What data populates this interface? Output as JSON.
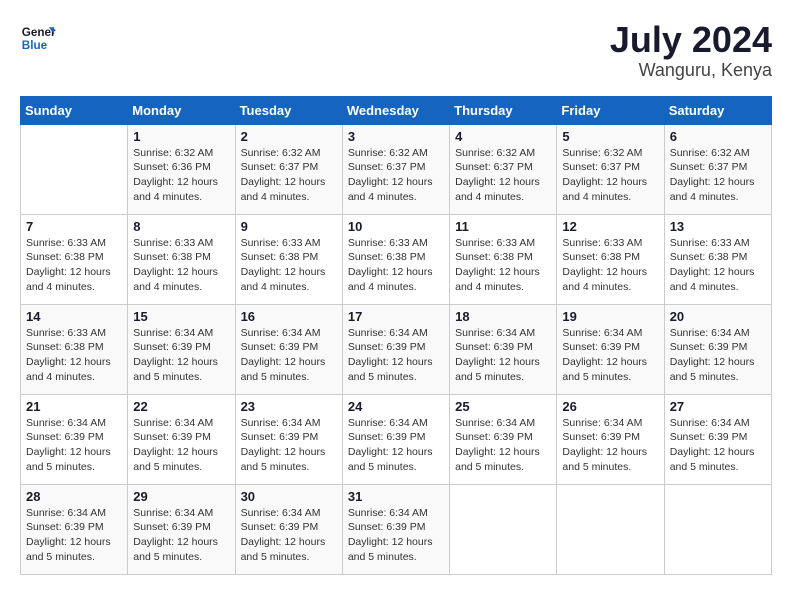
{
  "logo": {
    "line1": "General",
    "line2": "Blue"
  },
  "title": "July 2024",
  "location": "Wanguru, Kenya",
  "days_of_week": [
    "Sunday",
    "Monday",
    "Tuesday",
    "Wednesday",
    "Thursday",
    "Friday",
    "Saturday"
  ],
  "weeks": [
    [
      {
        "day": "",
        "sunrise": "",
        "sunset": "",
        "daylight": ""
      },
      {
        "day": "1",
        "sunrise": "Sunrise: 6:32 AM",
        "sunset": "Sunset: 6:36 PM",
        "daylight": "Daylight: 12 hours and 4 minutes."
      },
      {
        "day": "2",
        "sunrise": "Sunrise: 6:32 AM",
        "sunset": "Sunset: 6:37 PM",
        "daylight": "Daylight: 12 hours and 4 minutes."
      },
      {
        "day": "3",
        "sunrise": "Sunrise: 6:32 AM",
        "sunset": "Sunset: 6:37 PM",
        "daylight": "Daylight: 12 hours and 4 minutes."
      },
      {
        "day": "4",
        "sunrise": "Sunrise: 6:32 AM",
        "sunset": "Sunset: 6:37 PM",
        "daylight": "Daylight: 12 hours and 4 minutes."
      },
      {
        "day": "5",
        "sunrise": "Sunrise: 6:32 AM",
        "sunset": "Sunset: 6:37 PM",
        "daylight": "Daylight: 12 hours and 4 minutes."
      },
      {
        "day": "6",
        "sunrise": "Sunrise: 6:32 AM",
        "sunset": "Sunset: 6:37 PM",
        "daylight": "Daylight: 12 hours and 4 minutes."
      }
    ],
    [
      {
        "day": "7",
        "sunrise": "Sunrise: 6:33 AM",
        "sunset": "Sunset: 6:38 PM",
        "daylight": "Daylight: 12 hours and 4 minutes."
      },
      {
        "day": "8",
        "sunrise": "Sunrise: 6:33 AM",
        "sunset": "Sunset: 6:38 PM",
        "daylight": "Daylight: 12 hours and 4 minutes."
      },
      {
        "day": "9",
        "sunrise": "Sunrise: 6:33 AM",
        "sunset": "Sunset: 6:38 PM",
        "daylight": "Daylight: 12 hours and 4 minutes."
      },
      {
        "day": "10",
        "sunrise": "Sunrise: 6:33 AM",
        "sunset": "Sunset: 6:38 PM",
        "daylight": "Daylight: 12 hours and 4 minutes."
      },
      {
        "day": "11",
        "sunrise": "Sunrise: 6:33 AM",
        "sunset": "Sunset: 6:38 PM",
        "daylight": "Daylight: 12 hours and 4 minutes."
      },
      {
        "day": "12",
        "sunrise": "Sunrise: 6:33 AM",
        "sunset": "Sunset: 6:38 PM",
        "daylight": "Daylight: 12 hours and 4 minutes."
      },
      {
        "day": "13",
        "sunrise": "Sunrise: 6:33 AM",
        "sunset": "Sunset: 6:38 PM",
        "daylight": "Daylight: 12 hours and 4 minutes."
      }
    ],
    [
      {
        "day": "14",
        "sunrise": "Sunrise: 6:33 AM",
        "sunset": "Sunset: 6:38 PM",
        "daylight": "Daylight: 12 hours and 4 minutes."
      },
      {
        "day": "15",
        "sunrise": "Sunrise: 6:34 AM",
        "sunset": "Sunset: 6:39 PM",
        "daylight": "Daylight: 12 hours and 5 minutes."
      },
      {
        "day": "16",
        "sunrise": "Sunrise: 6:34 AM",
        "sunset": "Sunset: 6:39 PM",
        "daylight": "Daylight: 12 hours and 5 minutes."
      },
      {
        "day": "17",
        "sunrise": "Sunrise: 6:34 AM",
        "sunset": "Sunset: 6:39 PM",
        "daylight": "Daylight: 12 hours and 5 minutes."
      },
      {
        "day": "18",
        "sunrise": "Sunrise: 6:34 AM",
        "sunset": "Sunset: 6:39 PM",
        "daylight": "Daylight: 12 hours and 5 minutes."
      },
      {
        "day": "19",
        "sunrise": "Sunrise: 6:34 AM",
        "sunset": "Sunset: 6:39 PM",
        "daylight": "Daylight: 12 hours and 5 minutes."
      },
      {
        "day": "20",
        "sunrise": "Sunrise: 6:34 AM",
        "sunset": "Sunset: 6:39 PM",
        "daylight": "Daylight: 12 hours and 5 minutes."
      }
    ],
    [
      {
        "day": "21",
        "sunrise": "Sunrise: 6:34 AM",
        "sunset": "Sunset: 6:39 PM",
        "daylight": "Daylight: 12 hours and 5 minutes."
      },
      {
        "day": "22",
        "sunrise": "Sunrise: 6:34 AM",
        "sunset": "Sunset: 6:39 PM",
        "daylight": "Daylight: 12 hours and 5 minutes."
      },
      {
        "day": "23",
        "sunrise": "Sunrise: 6:34 AM",
        "sunset": "Sunset: 6:39 PM",
        "daylight": "Daylight: 12 hours and 5 minutes."
      },
      {
        "day": "24",
        "sunrise": "Sunrise: 6:34 AM",
        "sunset": "Sunset: 6:39 PM",
        "daylight": "Daylight: 12 hours and 5 minutes."
      },
      {
        "day": "25",
        "sunrise": "Sunrise: 6:34 AM",
        "sunset": "Sunset: 6:39 PM",
        "daylight": "Daylight: 12 hours and 5 minutes."
      },
      {
        "day": "26",
        "sunrise": "Sunrise: 6:34 AM",
        "sunset": "Sunset: 6:39 PM",
        "daylight": "Daylight: 12 hours and 5 minutes."
      },
      {
        "day": "27",
        "sunrise": "Sunrise: 6:34 AM",
        "sunset": "Sunset: 6:39 PM",
        "daylight": "Daylight: 12 hours and 5 minutes."
      }
    ],
    [
      {
        "day": "28",
        "sunrise": "Sunrise: 6:34 AM",
        "sunset": "Sunset: 6:39 PM",
        "daylight": "Daylight: 12 hours and 5 minutes."
      },
      {
        "day": "29",
        "sunrise": "Sunrise: 6:34 AM",
        "sunset": "Sunset: 6:39 PM",
        "daylight": "Daylight: 12 hours and 5 minutes."
      },
      {
        "day": "30",
        "sunrise": "Sunrise: 6:34 AM",
        "sunset": "Sunset: 6:39 PM",
        "daylight": "Daylight: 12 hours and 5 minutes."
      },
      {
        "day": "31",
        "sunrise": "Sunrise: 6:34 AM",
        "sunset": "Sunset: 6:39 PM",
        "daylight": "Daylight: 12 hours and 5 minutes."
      },
      {
        "day": "",
        "sunrise": "",
        "sunset": "",
        "daylight": ""
      },
      {
        "day": "",
        "sunrise": "",
        "sunset": "",
        "daylight": ""
      },
      {
        "day": "",
        "sunrise": "",
        "sunset": "",
        "daylight": ""
      }
    ]
  ]
}
